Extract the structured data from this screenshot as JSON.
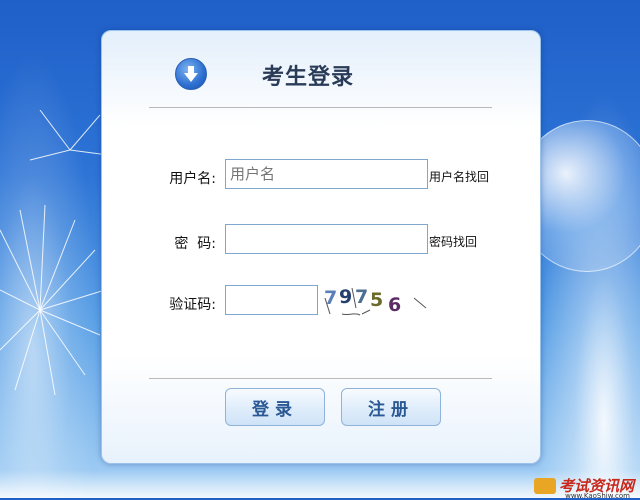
{
  "login": {
    "title": "考生登录",
    "username_label": "用户名:",
    "username_placeholder": "用户名",
    "username_value": "",
    "recover_username_link": "用户名找回",
    "password_label": "密  码:",
    "recover_password_link": "密码找回",
    "captcha_label": "验证码:",
    "captcha_chars": [
      "7",
      "9",
      "7",
      "5",
      "6"
    ],
    "captcha_colors": [
      "#5b7fb8",
      "#24406e",
      "#4c6e8f",
      "#6a6a2a",
      "#5b2b66"
    ],
    "login_button": "登录",
    "register_button": "注册"
  },
  "logo": {
    "text": "考试资讯网",
    "url": "www.KaoShiw.com"
  },
  "colors": {
    "accent": "#2a5894",
    "background_top": "#1f5fc8",
    "logo_red": "#c8281b"
  },
  "icons": {
    "title_icon": "down-arrow-circle-icon",
    "logo_icon": "logo-icon"
  }
}
